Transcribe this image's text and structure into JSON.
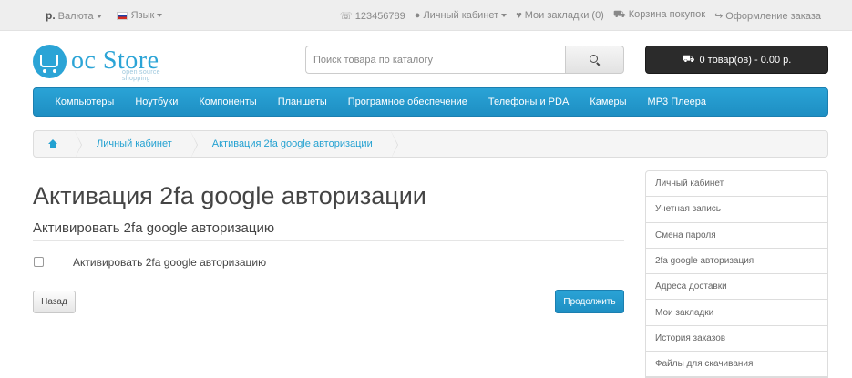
{
  "topbar": {
    "currency_symbol": "р.",
    "currency_label": "Валюта",
    "language_label": "Язык",
    "phone": "123456789",
    "account": "Личный кабинет",
    "wishlist": "Мои закладки (0)",
    "cart": "Корзина покупок",
    "checkout": "Оформление заказа"
  },
  "header": {
    "logo_brand": "oc Store",
    "logo_tagline": "open source shopping",
    "search_placeholder": "Поиск товара по каталогу",
    "cart_summary": "0 товар(ов) - 0.00 р."
  },
  "menu": {
    "items": [
      "Компьютеры",
      "Ноутбуки",
      "Компоненты",
      "Планшеты",
      "Програмное обеспечение",
      "Телефоны и PDA",
      "Камеры",
      "MP3 Плеера"
    ]
  },
  "breadcrumb": {
    "items": [
      "Личный кабинет",
      "Активация 2fa google авторизации"
    ]
  },
  "content": {
    "title": "Активация 2fa google авторизации",
    "section_title": "Активировать 2fa google авторизацию",
    "checkbox_label": "Активировать 2fa google авторизацию",
    "back_button": "Назад",
    "continue_button": "Продолжить"
  },
  "sidebar": {
    "items": [
      "Личный кабинет",
      "Учетная запись",
      "Смена пароля",
      "2fa google авторизация",
      "Адреса доставки",
      "Мои закладки",
      "История заказов",
      "Файлы для скачивания"
    ]
  },
  "colors": {
    "accent": "#2aa3d6",
    "cart_bg": "#2b2b2b",
    "topbar_bg": "#eeeeee"
  }
}
